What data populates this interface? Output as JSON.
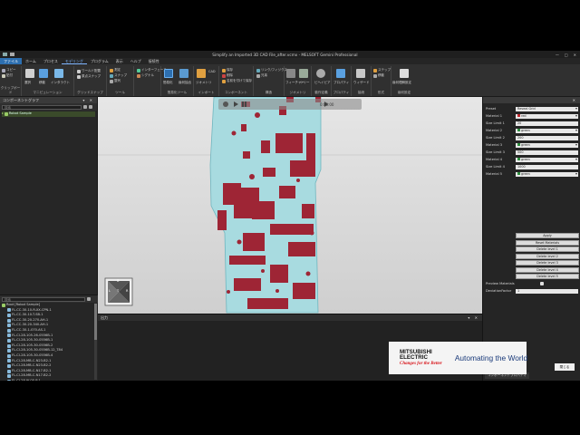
{
  "window": {
    "title": "Simplify an Imported 3D CAD File_after.vcmx - MELSOFT Gemini Professional",
    "controls": [
      "—",
      "□",
      "✕"
    ]
  },
  "menu": {
    "items": [
      "ファイル",
      "ホーム",
      "プロセス",
      "モデリング",
      "プログラム",
      "表示",
      "ヘルプ",
      "接続性"
    ]
  },
  "ribbon": {
    "groups": [
      {
        "label": "クリップボード",
        "items": [
          "コピー",
          "貼付"
        ]
      },
      {
        "label": "マニピュレーション",
        "items": [
          "選択",
          "移動",
          "インタラクト"
        ]
      },
      {
        "label": "グリッドスナップ",
        "items": [
          "ワールド配置",
          "原点スナップ"
        ]
      },
      {
        "label": "ツール",
        "items": [
          "測定",
          "スナップ",
          "整列"
        ]
      },
      {
        "label": "",
        "items": [
          "インターフェース",
          "シグナル"
        ]
      },
      {
        "label": "簡易化ツール",
        "items": [
          "簡易化",
          "幾何抽出"
        ]
      },
      {
        "label": "インポート",
        "items": [
          "ジオメトリ",
          "CAD"
        ]
      },
      {
        "label": "コンポーネント",
        "items": [
          "保存",
          "削除",
          "名前を付けて保存"
        ]
      },
      {
        "label": "構造",
        "items": [
          "リンク/フィジクス",
          "兄弟"
        ]
      },
      {
        "label": "ジオメトリ",
        "items": [
          "フィーチャー",
          "ツリー"
        ]
      },
      {
        "label": "動作定義",
        "items": [
          "サーボ",
          "ビヘイビア"
        ]
      },
      {
        "label": "プロパティ",
        "items": [
          "プロパティ"
        ]
      },
      {
        "label": "接続",
        "items": [
          "ウィザード"
        ]
      },
      {
        "label": "形式",
        "items": [
          "ステップ",
          "移動"
        ]
      },
      {
        "label": "幾何設定",
        "items": [
          "幾何理解設定"
        ]
      }
    ]
  },
  "left_panel": {
    "title": "コンポーネントグラフ",
    "search_placeholder": "検索",
    "top_tree": [
      "Robot Sample"
    ],
    "bottom_search_placeholder": "検索",
    "tree": [
      "Root [Robot Sample]",
      "FL-CC-30-10-R-XX-CPN-1",
      "FL-CC-30-10-T-SB-1",
      "FL-CC-30-20-270-AH-1",
      "FL-CC-30-20-340-AH-1",
      "FL-CC-30-1-070-AS-1",
      "FL-CI-28-105-26-0556B-1",
      "FL-CI-28-105-30-0556B-1",
      "FL-CI-28-105-30-0556B-2",
      "FL-CI-28-105-30-0556B-12_T84",
      "FL-CI-28-105-30-0556B-4",
      "FL-CI-28-MB-C-N23-B2-1",
      "FL-CI-28-MB-C-N23-B2-2",
      "FL-CI-28-MB-C-N17-B2-1",
      "FL-CI-28-MB-C-N17-B2-2",
      "FL-CI-28-IK-05-P-1",
      "FL-CI-28-IK-05-P-2",
      "FL-CI-28-IK-05-P-3",
      "FL-CI-28-IK-05-P-4",
      "FL-CI-CS-2050-DI-1",
      "FL-CI-CS-2050-DI-2"
    ]
  },
  "viewport": {
    "playbar_time": "0:00:00",
    "navcube": {
      "top": "B",
      "left": "L",
      "front": "T",
      "right": "R"
    }
  },
  "output": {
    "title": "出力"
  },
  "right_panel": {
    "preset_label": "Preset",
    "preset_value": "Reveal Grid",
    "rows": [
      {
        "label": "Material 1",
        "value": "red",
        "swatch": "#c0282e"
      },
      {
        "label": "Size Limit 1",
        "value": "20"
      },
      {
        "label": "Material 2",
        "value": "green",
        "swatch": "#2e8b3e"
      },
      {
        "label": "Size Limit 2",
        "value": "200"
      },
      {
        "label": "Material 3",
        "value": "green",
        "swatch": "#2e8b3e"
      },
      {
        "label": "Size Limit 3",
        "value": "500"
      },
      {
        "label": "Material 4",
        "value": "green",
        "swatch": "#2e8b3e"
      },
      {
        "label": "Size Limit 4",
        "value": "1000"
      },
      {
        "label": "Material 5",
        "value": "green",
        "swatch": "#2e8b3e"
      }
    ],
    "buttons": [
      "Apply",
      "Reset Materials",
      "Delete level 1",
      "Delete level 2",
      "Delete level 3",
      "Delete level 4",
      "Delete level 5"
    ],
    "preview_material_label": "Preview Materials",
    "deviation_label": "DeviationFactor",
    "deviation_value": "1",
    "footer_tab": "コンポーネントプロパティ"
  },
  "brand": {
    "line1": "MITSUBISHI",
    "line2": "ELECTRIC",
    "tagline": "Changes for the Better",
    "slogan": "Automating the World",
    "red": "#d8141a"
  },
  "overlay_button": "閉じる",
  "colors": {
    "accent": "#2d6fb0",
    "model_red": "#9e2535",
    "model_cyan": "#a8dbe0"
  }
}
